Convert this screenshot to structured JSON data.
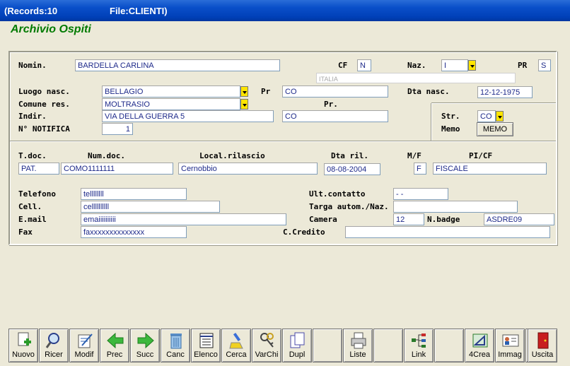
{
  "window": {
    "records": "(Records:10",
    "file": "File:CLIENTI)"
  },
  "heading": "Archivio Ospiti",
  "form": {
    "nomin_label": "Nomin.",
    "nomin": "BARDELLA CARLINA",
    "cf_label": "CF",
    "cf": "N",
    "naz_label": "Naz.",
    "naz": "I",
    "pr_label": "PR",
    "pr": "S",
    "country": "ITALIA",
    "luogo_label": "Luogo nasc.",
    "luogo": "BELLAGIO",
    "pr2_label": "Pr",
    "pr2": "CO",
    "dta_nasc_label": "Dta nasc.",
    "dta_nasc": "12-12-1975",
    "comune_label": "Comune res.",
    "comune": "MOLTRASIO",
    "pr3_label": "Pr.",
    "indir_label": "Indir.",
    "indir": "VIA DELLA GUERRA 5",
    "indir_pr": "CO",
    "notifica_label": "N° NOTIFICA",
    "notifica": "1",
    "str_label": "Str.",
    "str": "CO",
    "memo_label": "Memo",
    "memo_button": "MEMO",
    "tdoc_label": "T.doc.",
    "tdoc": "PAT.",
    "numdoc_label": "Num.doc.",
    "numdoc": "COMO1111111",
    "local_label": "Local.rilascio",
    "local": "Cernobbio",
    "dtaril_label": "Dta ril.",
    "dtaril": "08-08-2004",
    "mf_label": "M/F",
    "mf": "F",
    "picf_label": "PI/CF",
    "picf": "FISCALE",
    "tel_label": "Telefono",
    "tel": "tellllllll",
    "cell_label": "Cell.",
    "cell": "cellllllllll",
    "email_label": "E.mail",
    "email": "emaiiiiiiiiii",
    "fax_label": "Fax",
    "fax": "faxxxxxxxxxxxxxx",
    "ult_label": "Ult.contatto",
    "ult": "  -  -",
    "targa_label": "Targa autom./Naz.",
    "camera_label": "Camera",
    "camera": "12",
    "badge_label": "N.badge",
    "badge": "ASDRE09",
    "credito_label": "C.Credito"
  },
  "toolbar": [
    {
      "label": "Nuovo",
      "icon": "new-doc-icon"
    },
    {
      "label": "Ricer",
      "icon": "magnifier-icon"
    },
    {
      "label": "Modif",
      "icon": "edit-doc-icon"
    },
    {
      "label": "Prec",
      "icon": "arrow-left-icon"
    },
    {
      "label": "Succ",
      "icon": "arrow-right-icon"
    },
    {
      "label": "Canc",
      "icon": "trash-icon"
    },
    {
      "label": "Elenco",
      "icon": "list-icon"
    },
    {
      "label": "Cerca",
      "icon": "search-brush-icon"
    },
    {
      "label": "VarChi",
      "icon": "keys-icon"
    },
    {
      "label": "Dupl",
      "icon": "duplicate-icon"
    },
    {
      "label": "",
      "icon": ""
    },
    {
      "label": "Liste",
      "icon": "printer-icon"
    },
    {
      "label": "",
      "icon": ""
    },
    {
      "label": "Link",
      "icon": "network-icon"
    },
    {
      "label": "",
      "icon": ""
    },
    {
      "label": "4Crea",
      "icon": "design-icon"
    },
    {
      "label": "Immag",
      "icon": "id-card-icon"
    },
    {
      "label": "",
      "icon": ""
    },
    {
      "label": "Uscita",
      "icon": "exit-door-icon"
    }
  ]
}
